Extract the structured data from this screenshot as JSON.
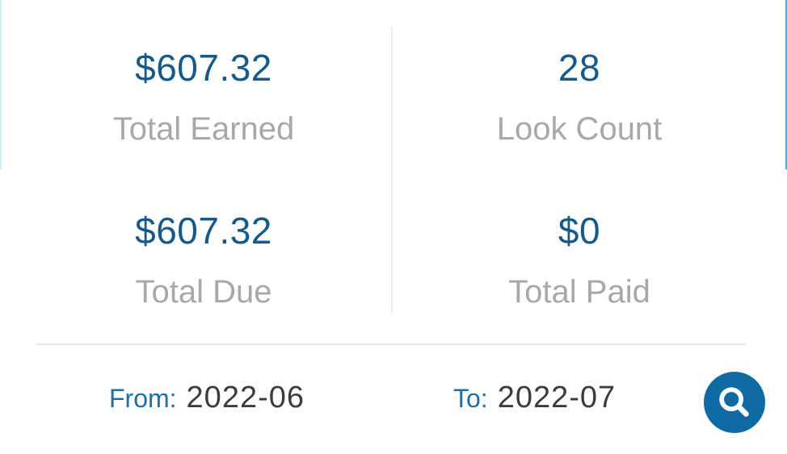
{
  "stats": {
    "total_earned": {
      "value": "$607.32",
      "label": "Total Earned"
    },
    "look_count": {
      "value": "28",
      "label": "Look Count"
    },
    "total_due": {
      "value": "$607.32",
      "label": "Total Due"
    },
    "total_paid": {
      "value": "$0",
      "label": "Total Paid"
    }
  },
  "filter": {
    "from_label": "From:",
    "from_value": "2022-06",
    "to_label": "To:",
    "to_value": "2022-07",
    "search_icon": "search-icon"
  },
  "colors": {
    "value_text": "#165a8a",
    "label_text": "#a8a8a8",
    "date_label": "#1d6fa8",
    "accent": "#0f6aa3"
  }
}
